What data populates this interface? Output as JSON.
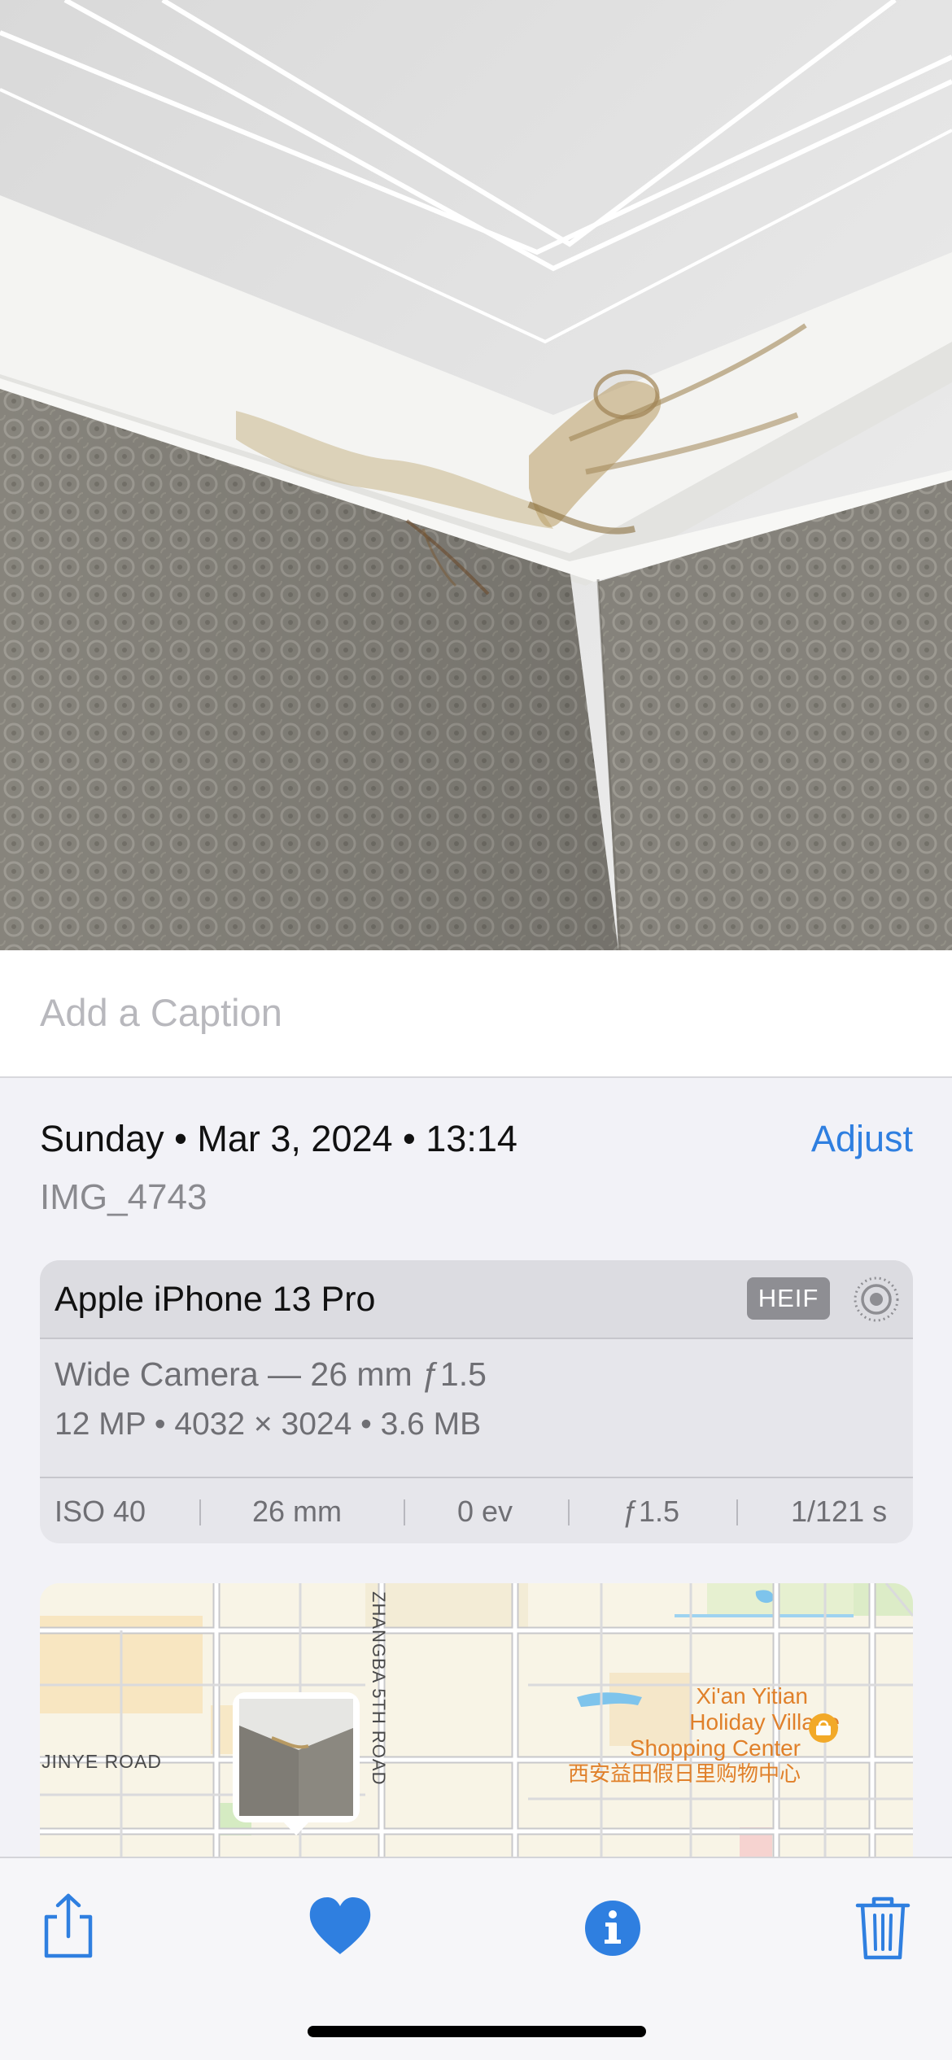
{
  "caption": {
    "placeholder": "Add a Caption",
    "value": ""
  },
  "info": {
    "date_line": "Sunday • Mar 3, 2024 • 13:14",
    "adjust_label": "Adjust",
    "filename": "IMG_4743"
  },
  "camera": {
    "device": "Apple iPhone 13 Pro",
    "format_badge": "HEIF",
    "live_icon": "live-photo-icon",
    "lens": "Wide Camera — 26 mm ƒ1.5",
    "specs": "12 MP  •  4032 × 3024  •  3.6 MB",
    "exif": [
      "ISO 40",
      "26 mm",
      "0 ev",
      "ƒ1.5",
      "1/121 s"
    ]
  },
  "map": {
    "labels": {
      "road_jinye": "JINYE ROAD",
      "road_zhangba": "ZHANGBA 5TH ROAD",
      "poi_line1": "Xi'an Yitian",
      "poi_line2": "Holiday Village",
      "poi_line3": "Shopping Center",
      "poi_chinese": "西安益田假日里购物中心"
    },
    "poi_icon": "shopping-bag-icon",
    "colors": {
      "poi_text": "#e0802a",
      "road": "#c9c9cc",
      "water": "#7ec4ec"
    }
  },
  "toolbar": {
    "icons": [
      "share-icon",
      "heart-icon",
      "info-icon",
      "trash-icon"
    ],
    "accent": "#2f7fe0"
  }
}
